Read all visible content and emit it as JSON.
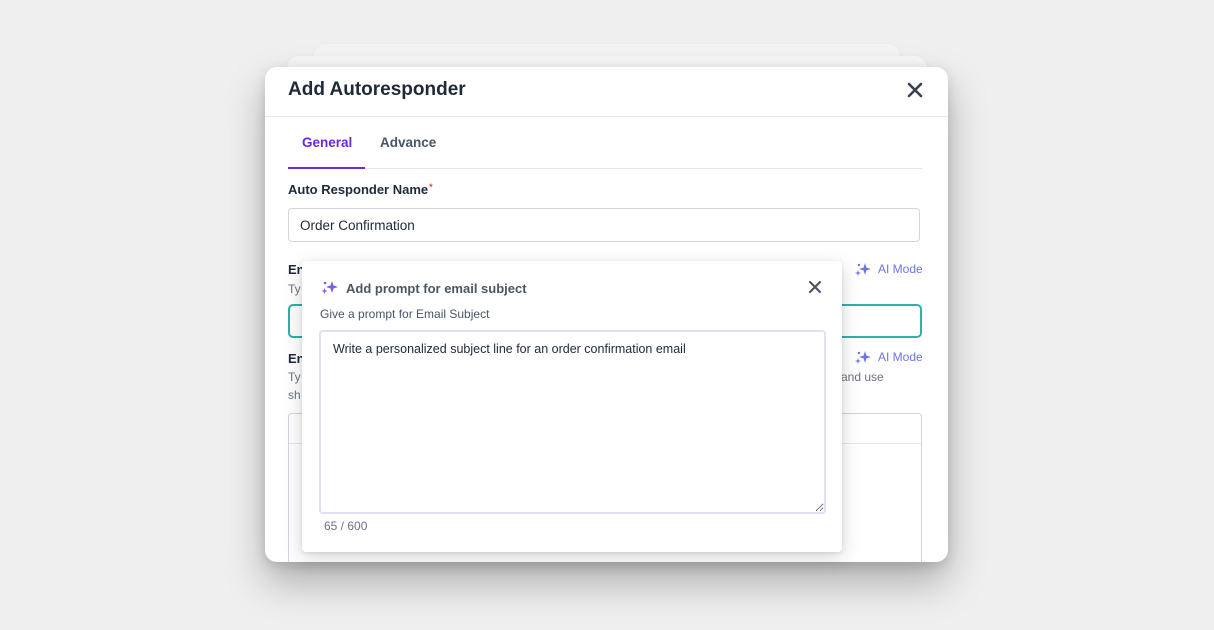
{
  "modal": {
    "title": "Add Autoresponder",
    "tabs": [
      {
        "label": "General",
        "active": true
      },
      {
        "label": "Advance",
        "active": false
      }
    ]
  },
  "form": {
    "name_label": "Auto Responder Name",
    "required_mark": "*",
    "name_value": "Order Confirmation",
    "subject_label_fragment": "En",
    "subject_hint_fragment": "Ty",
    "body_label_fragment": "En",
    "body_hint_fragment_left": "Ty",
    "body_hint_fragment_left2": "sh",
    "body_hint_fragment_right": "and use",
    "ai_mode_label": "AI Mode"
  },
  "prompt_popover": {
    "title": "Add prompt for email subject",
    "subtitle": "Give a prompt for Email Subject",
    "prompt_value": "Write a personalized subject line for an order confirmation email",
    "counter": "65 / 600"
  },
  "colors": {
    "accent": "#6d28d9",
    "ai_mode": "#6d74e0",
    "focus_border": "#2bb3a4",
    "background": "#efefef"
  },
  "icons": {
    "close": "close-icon",
    "sparkle": "sparkle-icon"
  }
}
